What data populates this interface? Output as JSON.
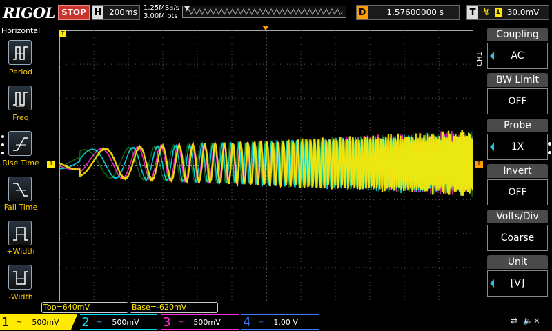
{
  "header": {
    "brand": "RIGOL",
    "run_state": "STOP",
    "horizontal_letter": "H",
    "timebase": "200ms",
    "sample_rate": "1.25MSa/s",
    "memory_depth": "3.00M pts",
    "delay_letter": "D",
    "delay": "1.57600000 s",
    "trigger_letter": "T",
    "trigger_source": "1",
    "trigger_level": "30.0mV"
  },
  "left_menu": {
    "title": "Horizontal",
    "items": [
      {
        "label": "Period",
        "icon": "period-icon"
      },
      {
        "label": "Freq",
        "icon": "freq-icon"
      },
      {
        "label": "Rise Time",
        "icon": "rise-time-icon"
      },
      {
        "label": "Fall Time",
        "icon": "fall-time-icon"
      },
      {
        "label": "+Width",
        "icon": "pos-width-icon"
      },
      {
        "label": "-Width",
        "icon": "neg-width-icon"
      }
    ]
  },
  "right_menu": {
    "channel_tag": "CH1",
    "items": [
      {
        "title": "Coupling",
        "value": "AC",
        "has_arrow": true
      },
      {
        "title": "BW Limit",
        "value": "OFF",
        "has_arrow": false
      },
      {
        "title": "Probe",
        "value": "1X",
        "has_arrow": true
      },
      {
        "title": "Invert",
        "value": "OFF",
        "has_arrow": false
      },
      {
        "title": "Volts/Div",
        "value": "Coarse",
        "has_arrow": false
      },
      {
        "title": "Unit",
        "value": "[V]",
        "has_arrow": true
      }
    ]
  },
  "measurements": {
    "top": "Top=640mV",
    "base": "Base=-620mV"
  },
  "channels": [
    {
      "num": "1",
      "scale": "500mV",
      "coupling": "~",
      "color": "#ffea00"
    },
    {
      "num": "2",
      "scale": "500mV",
      "coupling": "~",
      "color": "#00e0e8"
    },
    {
      "num": "3",
      "scale": "500mV",
      "coupling": "~",
      "color": "#ff2bd0"
    },
    {
      "num": "4",
      "scale": "1.00 V",
      "coupling": "=",
      "color": "#3a7bff"
    }
  ],
  "colors": {
    "ch1": "#ffea00",
    "ch2": "#00e0e8",
    "ch3": "#ff2bd0",
    "ch4": "#3a7bff",
    "menu_label": "#ffd000",
    "trigger_marker": "#ff9c00"
  },
  "markers": {
    "ch1_level": "1",
    "trigger_position": "T"
  }
}
